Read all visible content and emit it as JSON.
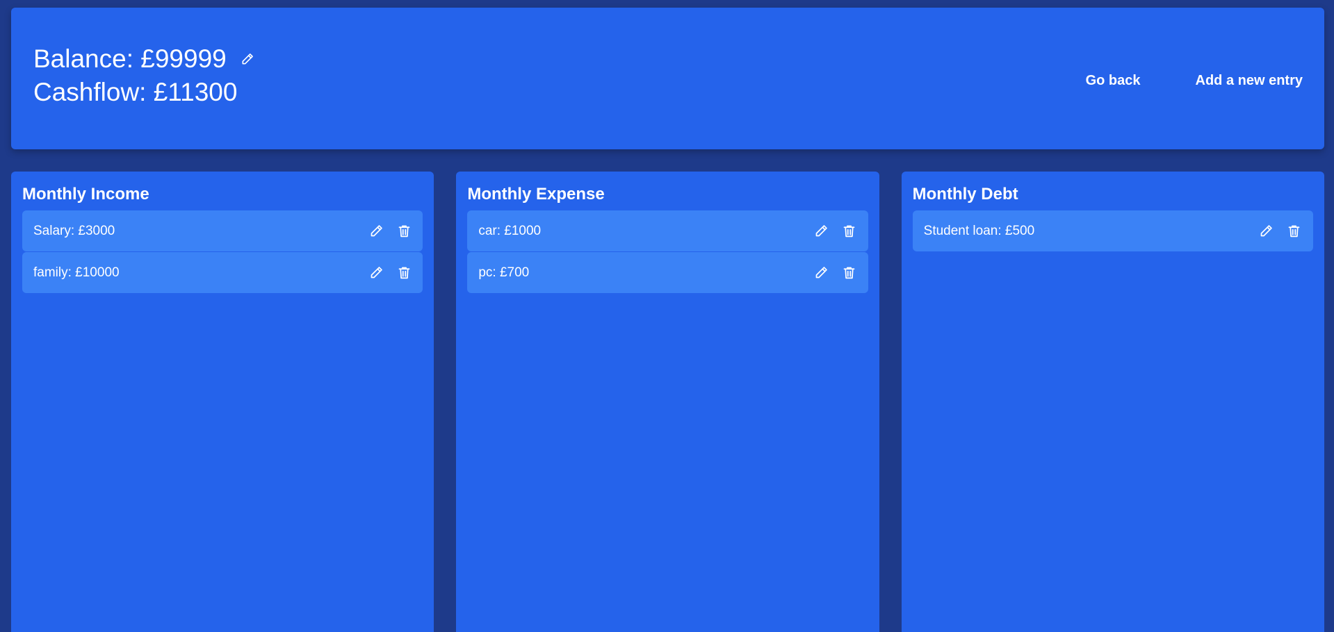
{
  "header": {
    "balance": "Balance: £99999",
    "cashflow": "Cashflow: £11300",
    "go_back_label": "Go back",
    "add_entry_label": "Add a new entry"
  },
  "icons": {
    "edit": "pencil-icon",
    "delete": "trash-icon"
  },
  "columns": {
    "income": {
      "title": "Monthly Income",
      "items": [
        {
          "label": "Salary: £3000"
        },
        {
          "label": "family: £10000"
        }
      ]
    },
    "expense": {
      "title": "Monthly Expense",
      "items": [
        {
          "label": "car: £1000"
        },
        {
          "label": "pc: £700"
        }
      ]
    },
    "debt": {
      "title": "Monthly Debt",
      "items": [
        {
          "label": "Student loan: £500"
        }
      ]
    }
  },
  "colors": {
    "page_background": "#1e3a8a",
    "panel": "#2563eb",
    "entry": "#3b82f6",
    "text": "#ffffff"
  }
}
